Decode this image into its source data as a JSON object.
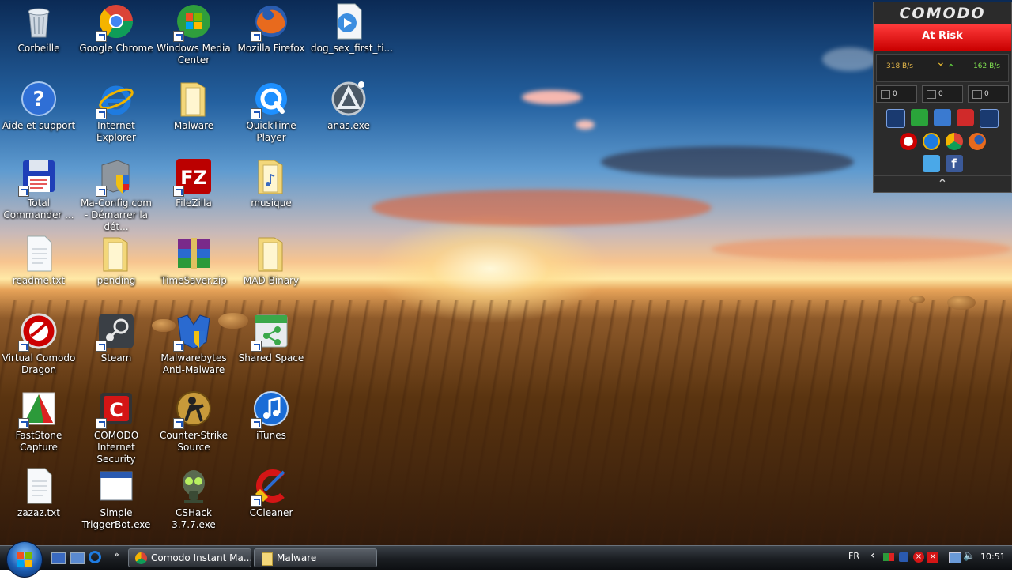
{
  "desktop": {
    "icons": [
      {
        "label": "Corbeille",
        "icon": "recycle-bin-icon",
        "shortcut": false
      },
      {
        "label": "Google Chrome",
        "icon": "chrome-icon",
        "shortcut": true
      },
      {
        "label": "Windows Media Center",
        "icon": "windows-media-center-icon",
        "shortcut": true
      },
      {
        "label": "Mozilla Firefox",
        "icon": "firefox-icon",
        "shortcut": true
      },
      {
        "label": "dog_sex_first_ti...",
        "icon": "video-file-icon",
        "shortcut": false
      },
      {
        "label": "Aide et support",
        "icon": "help-icon",
        "shortcut": false
      },
      {
        "label": "Internet Explorer",
        "icon": "internet-explorer-icon",
        "shortcut": true
      },
      {
        "label": "Malware",
        "icon": "folder-icon",
        "shortcut": false
      },
      {
        "label": "QuickTime Player",
        "icon": "quicktime-icon",
        "shortcut": true
      },
      {
        "label": "anas.exe",
        "icon": "exe-file-icon",
        "shortcut": false
      },
      {
        "label": "Total Commander ...",
        "icon": "floppy-disk-icon",
        "shortcut": true
      },
      {
        "label": "Ma-Config.com - Démarrer la dét...",
        "icon": "server-shield-icon",
        "shortcut": true
      },
      {
        "label": "FileZilla",
        "icon": "filezilla-icon",
        "shortcut": true
      },
      {
        "label": "musique",
        "icon": "folder-icon",
        "shortcut": false
      },
      {
        "label": "readme.txt",
        "icon": "text-file-icon",
        "shortcut": false
      },
      {
        "label": "pending",
        "icon": "folder-icon",
        "shortcut": false
      },
      {
        "label": "TimeSaver.zip",
        "icon": "winrar-archive-icon",
        "shortcut": false
      },
      {
        "label": "MAD Binary",
        "icon": "folder-icon",
        "shortcut": false
      },
      {
        "label": "Virtual Comodo Dragon",
        "icon": "comodo-dragon-icon",
        "shortcut": true
      },
      {
        "label": "Steam",
        "icon": "steam-icon",
        "shortcut": true
      },
      {
        "label": "Malwarebytes Anti-Malware",
        "icon": "malwarebytes-icon",
        "shortcut": true
      },
      {
        "label": "Shared Space",
        "icon": "shared-space-icon",
        "shortcut": true
      },
      {
        "label": "FastStone Capture",
        "icon": "faststone-icon",
        "shortcut": true
      },
      {
        "label": "COMODO Internet Security",
        "icon": "comodo-cis-icon",
        "shortcut": true
      },
      {
        "label": "Counter-Strike Source",
        "icon": "counter-strike-icon",
        "shortcut": true
      },
      {
        "label": "iTunes",
        "icon": "itunes-icon",
        "shortcut": true
      },
      {
        "label": "zazaz.txt",
        "icon": "text-file-icon",
        "shortcut": false
      },
      {
        "label": "Simple TriggerBot.exe",
        "icon": "window-app-icon",
        "shortcut": false
      },
      {
        "label": "CSHack 3.7.7.exe",
        "icon": "gas-mask-icon",
        "shortcut": false
      },
      {
        "label": "CCleaner",
        "icon": "ccleaner-icon",
        "shortcut": true
      }
    ]
  },
  "comodo_widget": {
    "logo": "COMODO",
    "status": "At Risk",
    "status_color": "#e01010",
    "download_rate": "318 B/s",
    "upload_rate": "162 B/s",
    "counters": [
      "0",
      "0",
      "0"
    ],
    "tools": [
      "task-manager-icon",
      "update-icon",
      "sandbox-icon",
      "record-icon",
      "activity-icon"
    ],
    "browsers": [
      "comodo-dragon-icon",
      "internet-explorer-icon",
      "chrome-icon",
      "firefox-icon"
    ],
    "social": [
      "twitter-icon",
      "facebook-icon"
    ]
  },
  "taskbar": {
    "tasks": [
      {
        "label": "Comodo Instant Ma...",
        "icon": "chrome-icon"
      },
      {
        "label": "Malware",
        "icon": "folder-icon"
      }
    ],
    "language": "FR",
    "time": "10:51"
  }
}
